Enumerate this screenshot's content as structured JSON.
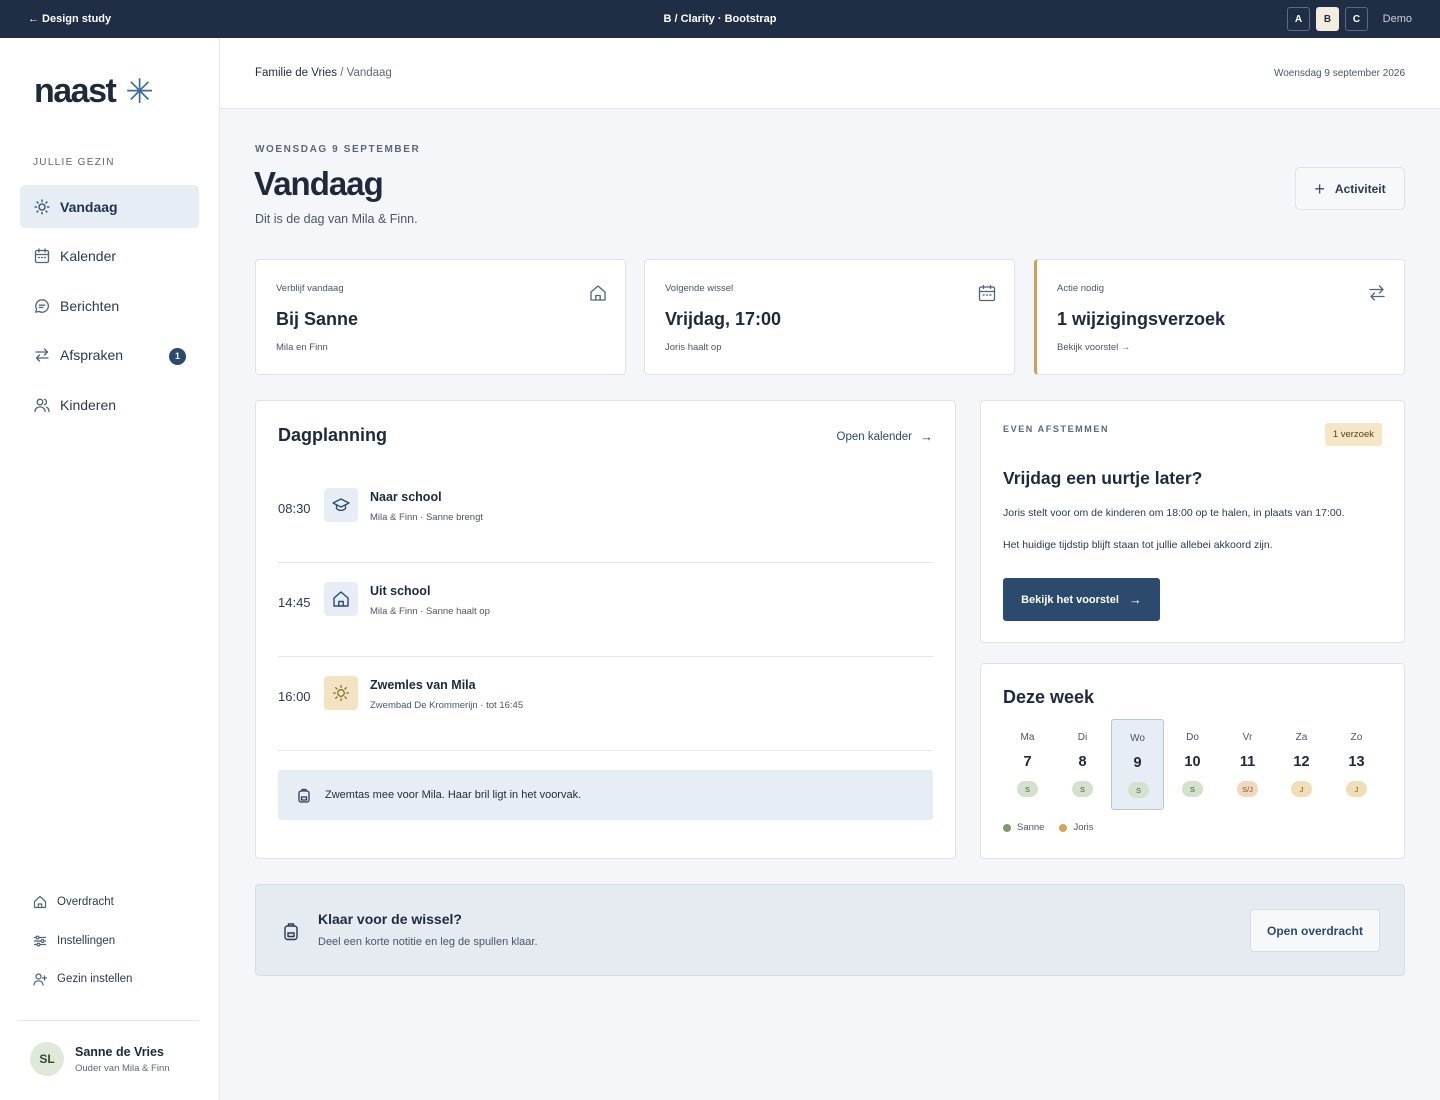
{
  "topbar": {
    "back_label": "← Design study",
    "title": "B / Clarity · Bootstrap",
    "variants": [
      "A",
      "B",
      "C"
    ],
    "demo_label": "Demo"
  },
  "brand": {
    "name": "naast",
    "mark": "✳"
  },
  "sidebar": {
    "section_label": "JULLIE GEZIN",
    "items": [
      {
        "label": "Vandaag",
        "icon": "sun-icon",
        "active": true
      },
      {
        "label": "Kalender",
        "icon": "calendar-icon"
      },
      {
        "label": "Berichten",
        "icon": "message-icon"
      },
      {
        "label": "Afspraken",
        "icon": "swap-icon",
        "badge": "1"
      },
      {
        "label": "Kinderen",
        "icon": "people-icon"
      }
    ],
    "secondary": [
      {
        "label": "Overdracht",
        "icon": "home-icon"
      },
      {
        "label": "Instellingen",
        "icon": "sliders-icon"
      },
      {
        "label": "Gezin instellen",
        "icon": "user-plus-icon"
      }
    ],
    "user": {
      "initials": "SL",
      "name": "Sanne de Vries",
      "role": "Ouder van Mila & Finn"
    }
  },
  "header": {
    "breadcrumb_parent": "Familie de Vries",
    "breadcrumb_separator": " / ",
    "breadcrumb_current": "Vandaag",
    "date": "Woensdag 9 september 2026"
  },
  "page": {
    "eyebrow": "WOENSDAG 9 SEPTEMBER",
    "title": "Vandaag",
    "subtitle": "Dit is de dag van Mila & Finn.",
    "add_button": "Activiteit"
  },
  "stats": [
    {
      "label": "Verblijf vandaag",
      "value": "Bij Sanne",
      "sub": "Mila en Finn",
      "icon": "home-icon"
    },
    {
      "label": "Volgende wissel",
      "value": "Vrijdag, 17:00",
      "sub": "Joris haalt op",
      "icon": "calendar-icon"
    },
    {
      "label": "Actie nodig",
      "value": "1 wijzigingsverzoek",
      "sub": "Bekijk voorstel →",
      "icon": "swap-icon"
    }
  ],
  "planning": {
    "title": "Dagplanning",
    "link": "Open kalender",
    "rows": [
      {
        "time": "08:30",
        "name": "Naar school",
        "meta": "Mila & Finn · Sanne brengt",
        "icon": "graduation-cap-icon"
      },
      {
        "time": "14:45",
        "name": "Uit school",
        "meta": "Mila & Finn · Sanne haalt op",
        "icon": "home-icon"
      },
      {
        "time": "16:00",
        "name": "Zwemles van Mila",
        "meta": "Zwembad De Krommerijn · tot 16:45",
        "icon": "sun-icon"
      }
    ],
    "note": "Zwemtas mee voor Mila. Haar bril ligt in het voorvak."
  },
  "tune": {
    "eyebrow": "EVEN AFSTEMMEN",
    "pill": "1 verzoek",
    "title": "Vrijdag een uurtje later?",
    "p1": "Joris stelt voor om de kinderen om 18:00 op te halen, in plaats van 17:00.",
    "p2": "Het huidige tijdstip blijft staan tot jullie allebei akkoord zijn.",
    "button": "Bekijk het voorstel"
  },
  "week": {
    "title": "Deze week",
    "days": [
      {
        "name": "Ma",
        "date": "7",
        "who": "S"
      },
      {
        "name": "Di",
        "date": "8",
        "who": "S"
      },
      {
        "name": "Wo",
        "date": "9",
        "who": "S",
        "today": true
      },
      {
        "name": "Do",
        "date": "10",
        "who": "S"
      },
      {
        "name": "Vr",
        "date": "11",
        "who": "S/J"
      },
      {
        "name": "Za",
        "date": "12",
        "who": "J"
      },
      {
        "name": "Zo",
        "date": "13",
        "who": "J"
      }
    ],
    "legend": [
      {
        "label": "Sanne",
        "color": "#7e9a72"
      },
      {
        "label": "Joris",
        "color": "#d3a55a"
      }
    ]
  },
  "banner": {
    "title": "Klaar voor de wissel?",
    "sub": "Deel een korte notitie en leg de spullen klaar.",
    "button": "Open overdracht"
  },
  "colors": {
    "navy": "#1f2e44",
    "accent": "#2b4a6e",
    "warm": "#c9a15a"
  }
}
